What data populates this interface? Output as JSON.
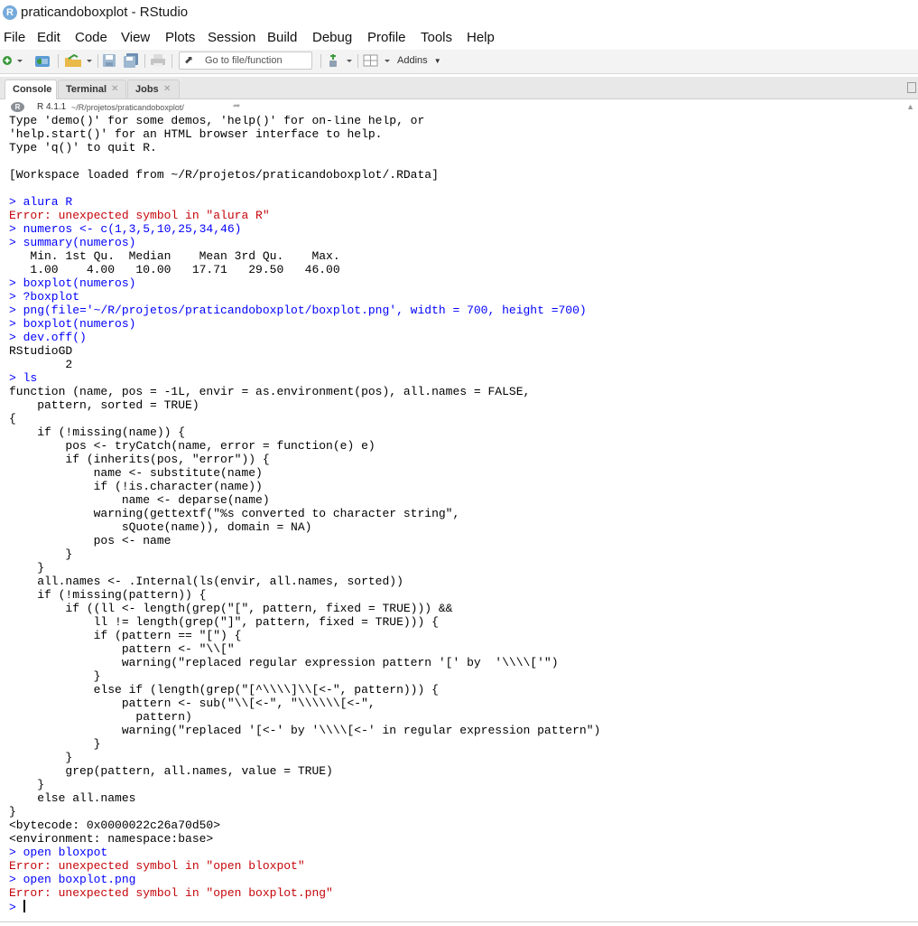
{
  "window": {
    "title": "praticandoboxplot - RStudio",
    "logo_text": "R"
  },
  "menu": [
    "File",
    "Edit",
    "Code",
    "View",
    "Plots",
    "Session",
    "Build",
    "Debug",
    "Profile",
    "Tools",
    "Help"
  ],
  "toolbar": {
    "goto_placeholder": "Go to file/function",
    "addins_label": "Addins"
  },
  "pane": {
    "tabs": [
      {
        "label": "Console",
        "closable": false
      },
      {
        "label": "Terminal",
        "closable": true
      },
      {
        "label": "Jobs",
        "closable": true
      }
    ],
    "r_version": "R 4.1.1",
    "path": "~/R/projetos/praticandoboxplot/"
  },
  "console": {
    "lines": [
      {
        "type": "output",
        "text": "Type 'demo()' for some demos, 'help()' for on-line help, or"
      },
      {
        "type": "output",
        "text": "'help.start()' for an HTML browser interface to help."
      },
      {
        "type": "output",
        "text": "Type 'q()' to quit R."
      },
      {
        "type": "output",
        "text": ""
      },
      {
        "type": "output",
        "text": "[Workspace loaded from ~/R/projetos/praticandoboxplot/.RData]"
      },
      {
        "type": "output",
        "text": ""
      },
      {
        "type": "input",
        "text": "> alura R"
      },
      {
        "type": "error",
        "text": "Error: unexpected symbol in \"alura R\""
      },
      {
        "type": "input",
        "text": "> numeros <- c(1,3,5,10,25,34,46)"
      },
      {
        "type": "input",
        "text": "> summary(numeros)"
      },
      {
        "type": "output",
        "text": "   Min. 1st Qu.  Median    Mean 3rd Qu.    Max. "
      },
      {
        "type": "output",
        "text": "   1.00    4.00   10.00   17.71   29.50   46.00 "
      },
      {
        "type": "input",
        "text": "> boxplot(numeros)"
      },
      {
        "type": "input",
        "text": "> ?boxplot"
      },
      {
        "type": "input",
        "text": "> png(file='~/R/projetos/praticandoboxplot/boxplot.png', width = 700, height =700)"
      },
      {
        "type": "input",
        "text": "> boxplot(numeros)"
      },
      {
        "type": "input",
        "text": "> dev.off()"
      },
      {
        "type": "output",
        "text": "RStudioGD "
      },
      {
        "type": "output",
        "text": "        2 "
      },
      {
        "type": "input",
        "text": "> ls"
      },
      {
        "type": "output",
        "text": "function (name, pos = -1L, envir = as.environment(pos), all.names = FALSE, "
      },
      {
        "type": "output",
        "text": "    pattern, sorted = TRUE) "
      },
      {
        "type": "output",
        "text": "{"
      },
      {
        "type": "output",
        "text": "    if (!missing(name)) {"
      },
      {
        "type": "output",
        "text": "        pos <- tryCatch(name, error = function(e) e)"
      },
      {
        "type": "output",
        "text": "        if (inherits(pos, \"error\")) {"
      },
      {
        "type": "output",
        "text": "            name <- substitute(name)"
      },
      {
        "type": "output",
        "text": "            if (!is.character(name)) "
      },
      {
        "type": "output",
        "text": "                name <- deparse(name)"
      },
      {
        "type": "output",
        "text": "            warning(gettextf(\"%s converted to character string\", "
      },
      {
        "type": "output",
        "text": "                sQuote(name)), domain = NA)"
      },
      {
        "type": "output",
        "text": "            pos <- name"
      },
      {
        "type": "output",
        "text": "        }"
      },
      {
        "type": "output",
        "text": "    }"
      },
      {
        "type": "output",
        "text": "    all.names <- .Internal(ls(envir, all.names, sorted))"
      },
      {
        "type": "output",
        "text": "    if (!missing(pattern)) {"
      },
      {
        "type": "output",
        "text": "        if ((ll <- length(grep(\"[\", pattern, fixed = TRUE))) && "
      },
      {
        "type": "output",
        "text": "            ll != length(grep(\"]\", pattern, fixed = TRUE))) {"
      },
      {
        "type": "output",
        "text": "            if (pattern == \"[\") {"
      },
      {
        "type": "output",
        "text": "                pattern <- \"\\\\[\""
      },
      {
        "type": "output",
        "text": "                warning(\"replaced regular expression pattern '[' by  '\\\\\\\\['\")"
      },
      {
        "type": "output",
        "text": "            }"
      },
      {
        "type": "output",
        "text": "            else if (length(grep(\"[^\\\\\\\\]\\\\[<-\", pattern))) {"
      },
      {
        "type": "output",
        "text": "                pattern <- sub(\"\\\\[<-\", \"\\\\\\\\\\\\[<-\", "
      },
      {
        "type": "output",
        "text": "                  pattern)"
      },
      {
        "type": "output",
        "text": "                warning(\"replaced '[<-' by '\\\\\\\\[<-' in regular expression pattern\")"
      },
      {
        "type": "output",
        "text": "            }"
      },
      {
        "type": "output",
        "text": "        }"
      },
      {
        "type": "output",
        "text": "        grep(pattern, all.names, value = TRUE)"
      },
      {
        "type": "output",
        "text": "    }"
      },
      {
        "type": "output",
        "text": "    else all.names"
      },
      {
        "type": "output",
        "text": "}"
      },
      {
        "type": "output",
        "text": "<bytecode: 0x0000022c26a70d50>"
      },
      {
        "type": "output",
        "text": "<environment: namespace:base>"
      },
      {
        "type": "input",
        "text": "> open bloxpot"
      },
      {
        "type": "error",
        "text": "Error: unexpected symbol in \"open bloxpot\""
      },
      {
        "type": "input",
        "text": "> open boxplot.png"
      },
      {
        "type": "error",
        "text": "Error: unexpected symbol in \"open boxplot.png\""
      }
    ],
    "prompt": "> "
  },
  "colors": {
    "input": "#0000ff",
    "error": "#c5060b",
    "output": "#000000"
  }
}
